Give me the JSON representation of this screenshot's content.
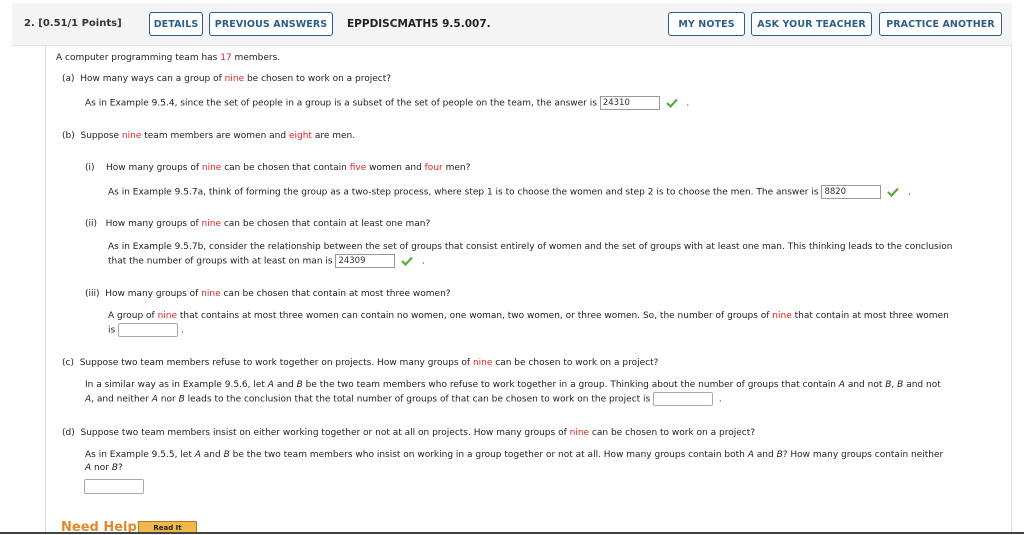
{
  "header": {
    "question_number": "2.",
    "points": "[0.51/1 Points]",
    "details_label": "DETAILS",
    "previous_answers_label": "PREVIOUS ANSWERS",
    "problem_code": "EPPDISCMATH5 9.5.007.",
    "my_notes_label": "MY NOTES",
    "ask_teacher_label": "ASK YOUR TEACHER",
    "practice_another_label": "PRACTICE ANOTHER"
  },
  "intro": {
    "pre": "A computer programming team has ",
    "num": "17",
    "post": " members."
  },
  "part_a": {
    "label": "(a)",
    "q_pre": "How many ways can a group of ",
    "q_red": "nine",
    "q_post": " be chosen to work on a project?",
    "hint": "As in Example 9.5.4, since the set of people in a group is a subset of the set of people on the team, the answer is",
    "answer": "24310",
    "status": "correct"
  },
  "part_b": {
    "label": "(b)",
    "q_pre": "Suppose ",
    "q_red1": "nine",
    "q_mid": " team members are women and ",
    "q_red2": "eight",
    "q_post": " are men.",
    "i": {
      "label": "(i)",
      "q_pre": "How many groups of ",
      "q_red1": "nine",
      "q_mid1": " can be chosen that contain ",
      "q_red2": "five",
      "q_mid2": " women and ",
      "q_red3": "four",
      "q_post": " men?",
      "hint": "As in Example 9.5.7a, think of forming the group as a two-step process, where step 1 is to choose the women and step 2 is to choose the men. The answer is",
      "answer": "8820",
      "status": "correct"
    },
    "ii": {
      "label": "(ii)",
      "q_pre": "How many groups of ",
      "q_red": "nine",
      "q_post": " can be chosen that contain at least one man?",
      "hint1": "As in Example 9.5.7b, consider the relationship between the set of groups that consist entirely of women and the set of groups with at least one man. This thinking leads to the conclusion",
      "hint2": "that the number of groups with at least on man is",
      "answer": "24309",
      "status": "correct"
    },
    "iii": {
      "label": "(iii)",
      "q_pre": "How many groups of ",
      "q_red": "nine",
      "q_post": " can be chosen that contain at most three women?",
      "hint_pre": "A group of ",
      "hint_red1": "nine",
      "hint_mid": " that contains at most three women can contain no women, one woman, two women, or three women. So, the number of groups of ",
      "hint_red2": "nine",
      "hint_post": " that contain at most three women",
      "hint2": "is",
      "answer": ""
    }
  },
  "part_c": {
    "label": "(c)",
    "q_pre": "Suppose two team members refuse to work together on projects. How many groups of ",
    "q_red": "nine",
    "q_post": " can be chosen to work on a project?",
    "hint1_a": "In a similar way as in Example 9.5.6, let ",
    "A": "A",
    "and": " and ",
    "B": "B",
    "hint1_b": " be the two team members who refuse to work together in a group. Thinking about the number of groups that contain ",
    "hint1_c": " and not ",
    "hint1_d": ", ",
    "hint1_e": " and not",
    "hint2_a": ", and neither ",
    "hint2_b": " nor ",
    "hint2_c": " leads to the conclusion that the total number of groups of that can be chosen to work on the project is",
    "answer": ""
  },
  "part_d": {
    "label": "(d)",
    "q_pre": "Suppose two team members insist on either working together or not at all on projects. How many groups of ",
    "q_red": "nine",
    "q_post": " can be chosen to work on a project?",
    "hint1_a": "As in Example 9.5.5, let ",
    "hint1_b": " be the two team members who insist on working in a group together or not at all. How many groups contain both ",
    "hint1_c": "? How many groups contain neither",
    "hint2_a": " nor ",
    "hint2_b": "?",
    "answer": ""
  },
  "help": {
    "need_help": "Need Help?",
    "read_it": "Read It"
  },
  "punct": {
    "period": "."
  }
}
